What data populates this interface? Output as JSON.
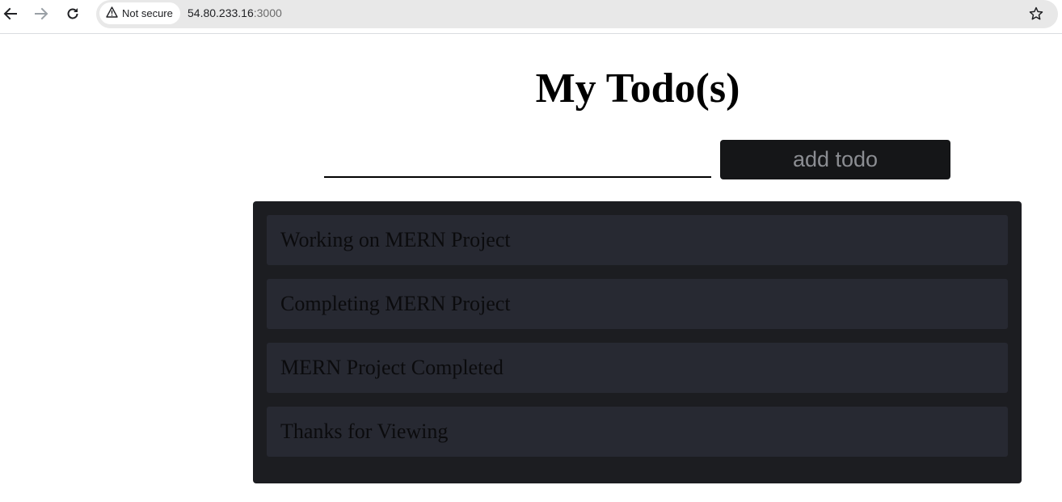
{
  "browser": {
    "security_label": "Not secure",
    "url_host": "54.80.233.16",
    "url_port": ":3000",
    "icons": {
      "back": "arrow-left-icon",
      "forward": "arrow-right-icon",
      "reload": "reload-icon",
      "warning": "warning-triangle-icon",
      "bookmark": "star-icon"
    }
  },
  "app": {
    "title": "My Todo(s)",
    "input": {
      "value": "",
      "placeholder": ""
    },
    "add_button_label": "add todo",
    "todos": [
      {
        "text": "Working on MERN Project"
      },
      {
        "text": "Completing MERN Project"
      },
      {
        "text": "MERN Project Completed"
      },
      {
        "text": "Thanks for Viewing"
      }
    ]
  },
  "colors": {
    "panel_bg": "#1c1d21",
    "item_bg": "#272932",
    "button_bg": "#151618",
    "button_text": "#8b8d92"
  }
}
